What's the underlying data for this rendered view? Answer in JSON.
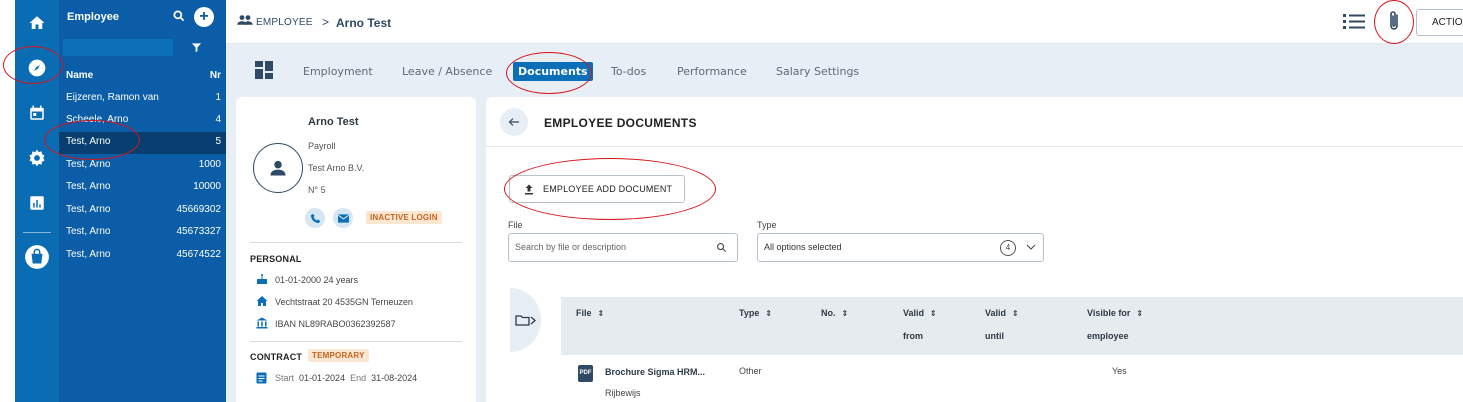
{
  "nav": {
    "items": [
      "home-icon",
      "compass-icon",
      "calendar-icon",
      "gear-icon",
      "chart-icon",
      "bag-icon"
    ]
  },
  "employees": {
    "title": "Employee",
    "add_symbol": "+",
    "columns": {
      "name": "Name",
      "nr": "Nr"
    },
    "rows": [
      {
        "name": "Eijzeren, Ramon van",
        "nr": "1"
      },
      {
        "name": "Scheele, Arno",
        "nr": "4"
      },
      {
        "name": "Test, Arno",
        "nr": "5",
        "selected": true
      },
      {
        "name": "Test, Arno",
        "nr": "1000"
      },
      {
        "name": "Test, Arno",
        "nr": "10000"
      },
      {
        "name": "Test, Arno",
        "nr": "45669302"
      },
      {
        "name": "Test, Arno",
        "nr": "45673327"
      },
      {
        "name": "Test, Arno",
        "nr": "45674522"
      }
    ]
  },
  "header": {
    "breadcrumb_section": "EMPLOYEE",
    "breadcrumb_separator": ">",
    "breadcrumb_current": "Arno Test",
    "actions_label": "ACTIONS"
  },
  "tabs": [
    {
      "label": "Employment"
    },
    {
      "label": "Leave / Absence"
    },
    {
      "label": "Documents",
      "active": true
    },
    {
      "label": "To-dos"
    },
    {
      "label": "Performance"
    },
    {
      "label": "Salary Settings"
    }
  ],
  "profile": {
    "name": "Arno Test",
    "department": "Payroll",
    "company": "Test Arno B.V.",
    "number": "N° 5",
    "login_badge": "INACTIVE LOGIN",
    "personal_heading": "PERSONAL",
    "birth": "01-01-2000  24 years",
    "address": "Vechtstraat 20 4535GN Terneuzen",
    "iban": "IBAN NL89RABO0362392587",
    "contract_heading": "CONTRACT",
    "contract_badge": "TEMPORARY",
    "start_label": "Start",
    "start_date": "01-01-2024",
    "end_label": "End",
    "end_date": "31-08-2024"
  },
  "documents": {
    "title": "EMPLOYEE DOCUMENTS",
    "add_button": "EMPLOYEE ADD DOCUMENT",
    "file_label": "File",
    "file_placeholder": "Search by file or description",
    "type_label": "Type",
    "type_value": "All options selected",
    "type_count": "4",
    "columns": {
      "file": "File",
      "type": "Type",
      "no": "No.",
      "valid_from_1": "Valid",
      "valid_from_2": "from",
      "valid_until_1": "Valid",
      "valid_until_2": "until",
      "visible_1": "Visible for",
      "visible_2": "employee"
    },
    "rows": [
      {
        "file": "Brochure Sigma HRM...",
        "description": "Rijbewijs",
        "type": "Other",
        "visible": "Yes",
        "icon_label": "PDF"
      }
    ]
  },
  "colors": {
    "nav_bg": "#0a6db3",
    "list_bg": "#0b5da8",
    "selected_row": "#074070",
    "accent": "#0b6fb8",
    "badge_text": "#c8641e",
    "badge_bg": "#fbe6d2",
    "annotation": "#d7141a"
  }
}
